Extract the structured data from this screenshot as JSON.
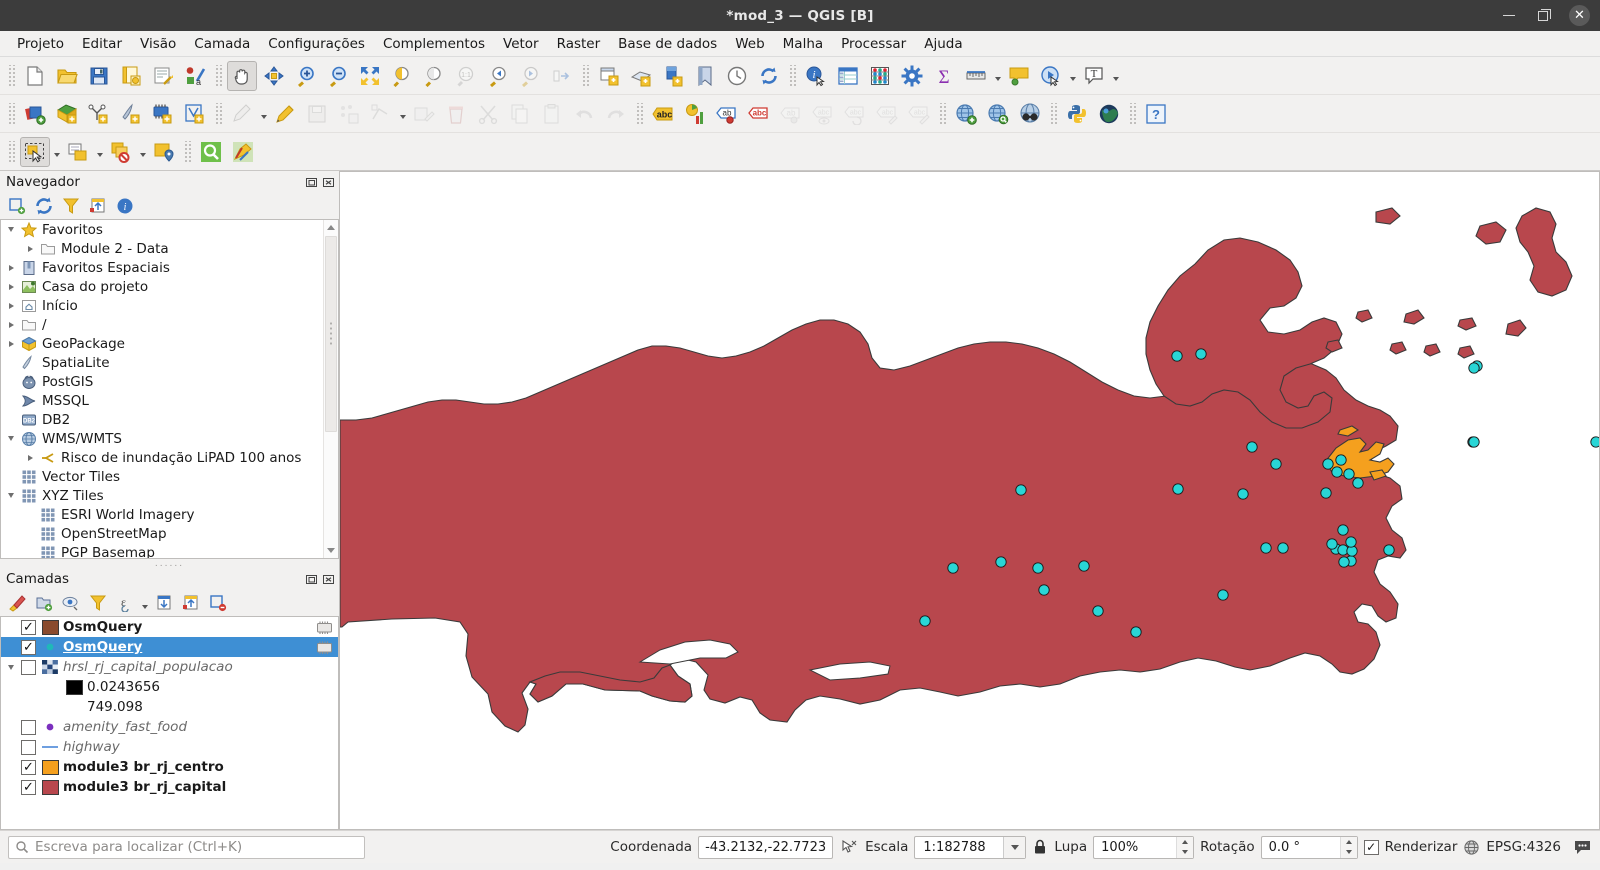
{
  "window": {
    "title": "*mod_3 — QGIS [B]",
    "minimize": "minimize",
    "maximize": "maximize",
    "close": "close"
  },
  "menubar": {
    "items": [
      {
        "label": "Projeto",
        "mnemonic": "P"
      },
      {
        "label": "Editar",
        "mnemonic": "E"
      },
      {
        "label": "Visão",
        "mnemonic": "V"
      },
      {
        "label": "Camada",
        "mnemonic": "C"
      },
      {
        "label": "Configurações",
        "mnemonic": "C"
      },
      {
        "label": "Complementos",
        "mnemonic": "C"
      },
      {
        "label": "Vetor",
        "mnemonic": "o"
      },
      {
        "label": "Raster",
        "mnemonic": "R"
      },
      {
        "label": "Base de dados",
        "mnemonic": "B"
      },
      {
        "label": "Web",
        "mnemonic": "W"
      },
      {
        "label": "Malha",
        "mnemonic": "M"
      },
      {
        "label": "Processar",
        "mnemonic": "c"
      },
      {
        "label": "Ajuda",
        "mnemonic": "A"
      }
    ]
  },
  "toolbar_row1": [
    {
      "name": "new-project-button",
      "icon": "new-document-icon"
    },
    {
      "name": "open-project-button",
      "icon": "open-folder-icon"
    },
    {
      "name": "save-project-button",
      "icon": "save-disk-icon"
    },
    {
      "name": "save-project-as-button",
      "icon": "save-as-icon"
    },
    {
      "name": "new-print-layout-button",
      "icon": "layout-designer-icon"
    },
    {
      "name": "style-manager-button",
      "icon": "style-manager-icon"
    },
    {
      "name": "pan-map-button",
      "icon": "pan-hand-icon",
      "pressed": true
    },
    {
      "name": "pan-to-selection-button",
      "icon": "pan-selection-icon"
    },
    {
      "name": "zoom-in-button",
      "icon": "zoom-in-icon"
    },
    {
      "name": "zoom-out-button",
      "icon": "zoom-out-icon"
    },
    {
      "name": "zoom-full-button",
      "icon": "zoom-full-icon"
    },
    {
      "name": "zoom-to-selection-button",
      "icon": "zoom-selection-icon"
    },
    {
      "name": "zoom-to-layer-button",
      "icon": "zoom-layer-icon"
    },
    {
      "name": "zoom-native-button",
      "icon": "zoom-native-1-1-icon",
      "dim": true
    },
    {
      "name": "zoom-last-button",
      "icon": "zoom-last-icon"
    },
    {
      "name": "zoom-next-button",
      "icon": "zoom-next-icon",
      "dim": true
    },
    {
      "name": "refresh-extent-button",
      "icon": "zoom-next-2-icon",
      "dim": true
    },
    {
      "name": "new-map-view-button",
      "icon": "new-map-view-icon"
    },
    {
      "name": "new-3d-map-view-button",
      "icon": "new-3d-map-view-icon"
    },
    {
      "name": "new-print-layout-2-button",
      "icon": "new-print-layout-icon"
    },
    {
      "name": "show-bookmarks-button",
      "icon": "bookmarks-icon"
    },
    {
      "name": "temporal-controller-button",
      "icon": "clock-icon"
    },
    {
      "name": "refresh-button",
      "icon": "refresh-icon"
    },
    {
      "name": "identify-features-button",
      "icon": "identify-info-icon"
    },
    {
      "name": "open-attribute-table-button",
      "icon": "attribute-table-icon"
    },
    {
      "name": "statistical-summary-button",
      "icon": "abacus-statistics-icon"
    },
    {
      "name": "processing-toolbox-button",
      "icon": "gear-processing-icon"
    },
    {
      "name": "field-calculator-button",
      "icon": "sigma-icon"
    },
    {
      "name": "measure-line-button",
      "icon": "ruler-measure-icon",
      "dropdown": true
    },
    {
      "name": "map-tips-button",
      "icon": "map-tips-icon"
    },
    {
      "name": "show-actions-button",
      "icon": "run-action-icon",
      "dropdown": true
    },
    {
      "name": "new-text-annotation-button",
      "icon": "text-annotation-icon",
      "dropdown": true
    }
  ],
  "toolbar_row2": [
    {
      "name": "open-data-source-manager-button",
      "icon": "data-source-manager-icon"
    },
    {
      "name": "add-vector-layer-button",
      "icon": "add-vector-layer-icon"
    },
    {
      "name": "add-delimited-text-layer-button",
      "icon": "add-delimited-text-icon"
    },
    {
      "name": "add-spatialite-layer-button",
      "icon": "add-spatialite-icon"
    },
    {
      "name": "add-mesh-layer-button",
      "icon": "add-mesh-layer-icon"
    },
    {
      "name": "add-virtual-layer-button",
      "icon": "add-virtual-layer-icon"
    },
    {
      "name": "current-edits-button",
      "icon": "current-edits-icon",
      "dim": true,
      "dropdown": true
    },
    {
      "name": "toggle-editing-button",
      "icon": "pencil-edit-icon"
    },
    {
      "name": "save-layer-edits-button",
      "icon": "save-edits-icon",
      "dim": true
    },
    {
      "name": "add-feature-button",
      "icon": "add-point-feature-icon",
      "dim": true
    },
    {
      "name": "vertex-tool-button",
      "icon": "vertex-tool-icon",
      "dim": true,
      "dropdown": true
    },
    {
      "name": "modify-attributes-button",
      "icon": "modify-attributes-icon",
      "dim": true
    },
    {
      "name": "delete-selected-button",
      "icon": "trash-delete-icon",
      "dim": true
    },
    {
      "name": "cut-features-button",
      "icon": "scissors-cut-icon",
      "dim": true
    },
    {
      "name": "copy-features-button",
      "icon": "copy-features-icon",
      "dim": true
    },
    {
      "name": "paste-features-button",
      "icon": "paste-features-icon",
      "dim": true
    },
    {
      "name": "undo-button",
      "icon": "undo-arrow-icon",
      "dim": true
    },
    {
      "name": "redo-button",
      "icon": "redo-arrow-icon",
      "dim": true
    },
    {
      "name": "layer-labeling-button",
      "icon": "label-abc-icon"
    },
    {
      "name": "layer-diagrams-button",
      "icon": "diagram-chart-icon"
    },
    {
      "name": "pin-labels-button",
      "icon": "pin-label-icon"
    },
    {
      "name": "highlight-labels-button",
      "icon": "highlight-label-icon"
    },
    {
      "name": "move-label-button",
      "icon": "move-label-icon",
      "dim": true
    },
    {
      "name": "show-hide-labels-button",
      "icon": "show-hide-label-icon",
      "dim": true
    },
    {
      "name": "rotate-label-button",
      "icon": "rotate-label-icon",
      "dim": true
    },
    {
      "name": "change-label-button",
      "icon": "change-label-icon",
      "dim": true
    },
    {
      "name": "label-properties-button",
      "icon": "label-properties-icon",
      "dim": true
    },
    {
      "name": "add-wms-layer-button",
      "icon": "globe-add-icon"
    },
    {
      "name": "metasearch-button",
      "icon": "globe-search-icon"
    },
    {
      "name": "inspect-globe-button",
      "icon": "globe-binoculars-icon"
    },
    {
      "name": "python-console-button",
      "icon": "python-console-icon"
    },
    {
      "name": "plugin-manager-button",
      "icon": "plugin-globe-icon"
    },
    {
      "name": "help-button",
      "icon": "help-question-icon"
    }
  ],
  "toolbar_row3": [
    {
      "name": "select-features-button",
      "icon": "select-features-icon",
      "pressed": true,
      "dropdown": true
    },
    {
      "name": "select-by-expression-button",
      "icon": "select-by-form-icon",
      "dropdown": true
    },
    {
      "name": "deselect-features-button",
      "icon": "deselect-all-icon",
      "dropdown": true
    },
    {
      "name": "select-value-button",
      "icon": "select-location-icon"
    },
    {
      "name": "osm-query-search-button",
      "icon": "magnifier-green-icon"
    },
    {
      "name": "qgis-plugin-button",
      "icon": "paint-plugin-icon"
    }
  ],
  "navigator": {
    "title": "Navegador",
    "panel_buttons": [
      {
        "name": "add-layer-button",
        "icon": "add-layer-icon"
      },
      {
        "name": "refresh-button",
        "icon": "refresh-icon"
      },
      {
        "name": "filter-browser-button",
        "icon": "filter-funnel-icon"
      },
      {
        "name": "collapse-all-button",
        "icon": "collapse-all-icon"
      },
      {
        "name": "show-properties-button",
        "icon": "info-icon"
      }
    ],
    "items": [
      {
        "label": "Favoritos",
        "icon": "star-icon",
        "indent": 0,
        "twisty": "down"
      },
      {
        "label": "Module 2 - Data",
        "icon": "folder-icon",
        "indent": 1,
        "twisty": "right"
      },
      {
        "label": "Favoritos Espaciais",
        "icon": "spatial-bookmark-icon",
        "indent": 0,
        "twisty": "right"
      },
      {
        "label": "Casa do projeto",
        "icon": "project-home-icon",
        "indent": 0,
        "twisty": "right"
      },
      {
        "label": "Início",
        "icon": "home-icon",
        "indent": 0,
        "twisty": "right"
      },
      {
        "label": "/",
        "icon": "folder-root-icon",
        "indent": 0,
        "twisty": "right"
      },
      {
        "label": "GeoPackage",
        "icon": "geopackage-icon",
        "indent": 0,
        "twisty": "right"
      },
      {
        "label": "SpatiaLite",
        "icon": "spatialite-icon",
        "indent": 0,
        "twisty": "none"
      },
      {
        "label": "PostGIS",
        "icon": "postgis-elephant-icon",
        "indent": 0,
        "twisty": "none"
      },
      {
        "label": "MSSQL",
        "icon": "mssql-icon",
        "indent": 0,
        "twisty": "none"
      },
      {
        "label": "DB2",
        "icon": "db2-icon",
        "indent": 0,
        "twisty": "none"
      },
      {
        "label": "WMS/WMTS",
        "icon": "wms-globe-icon",
        "indent": 0,
        "twisty": "down"
      },
      {
        "label": "Risco de inundação LiPAD 100 anos",
        "icon": "wms-connection-icon",
        "indent": 1,
        "twisty": "right"
      },
      {
        "label": "Vector Tiles",
        "icon": "vector-tiles-icon",
        "indent": 0,
        "twisty": "none"
      },
      {
        "label": "XYZ Tiles",
        "icon": "xyz-tiles-icon",
        "indent": 0,
        "twisty": "down"
      },
      {
        "label": "ESRI World Imagery",
        "icon": "xyz-tile-icon",
        "indent": 1,
        "twisty": "none"
      },
      {
        "label": "OpenStreetMap",
        "icon": "xyz-tile-icon",
        "indent": 1,
        "twisty": "none"
      },
      {
        "label": "PGP Basemap",
        "icon": "xyz-tile-icon",
        "indent": 1,
        "twisty": "none"
      }
    ]
  },
  "layers": {
    "title": "Camadas",
    "panel_buttons": [
      {
        "name": "open-layer-styling-button",
        "icon": "style-brush-icon"
      },
      {
        "name": "add-group-button",
        "icon": "add-group-icon"
      },
      {
        "name": "manage-visibility-button",
        "icon": "eye-visibility-icon"
      },
      {
        "name": "filter-legend-button",
        "icon": "filter-funnel-icon"
      },
      {
        "name": "filter-legend-expression-button",
        "icon": "epsilon-filter-icon",
        "dropdown": true
      },
      {
        "name": "expand-all-button",
        "icon": "expand-all-icon"
      },
      {
        "name": "collapse-all-button",
        "icon": "collapse-all-icon"
      },
      {
        "name": "remove-layer-button",
        "icon": "remove-layer-icon"
      }
    ],
    "items": [
      {
        "label": "OsmQuery",
        "checked": true,
        "symbol": "swatch",
        "color": "#8a4b2e",
        "style": "bold",
        "indent": 0,
        "selected": false,
        "badge": "editable-icon"
      },
      {
        "label": "OsmQuery",
        "checked": true,
        "symbol": "dot",
        "color": "#1fb8b8",
        "style": "bold",
        "indent": 0,
        "selected": true,
        "badge": "editable-icon"
      },
      {
        "label": "hrsl_rj_capital_populacao",
        "checked": false,
        "symbol": "raster",
        "color": "#2b4a8c",
        "style": "italic",
        "indent": 0,
        "selected": false,
        "twisty": "down"
      },
      {
        "label": "0.0243656",
        "checked": null,
        "symbol": "swatch",
        "color": "#000000",
        "style": "plain",
        "indent": 1,
        "selected": false
      },
      {
        "label": "749.098",
        "checked": null,
        "symbol": "none",
        "color": "#ffffff",
        "style": "plain",
        "indent": 1,
        "selected": false
      },
      {
        "label": "amenity_fast_food",
        "checked": false,
        "symbol": "dot",
        "color": "#7b2fbe",
        "style": "italic",
        "indent": 0,
        "selected": false
      },
      {
        "label": "highway",
        "checked": false,
        "symbol": "line",
        "color": "#6e9fe0",
        "style": "italic",
        "indent": 0,
        "selected": false
      },
      {
        "label": "module3 br_rj_centro",
        "checked": true,
        "symbol": "swatch",
        "color": "#f5a01e",
        "style": "bold",
        "indent": 0,
        "selected": false
      },
      {
        "label": "module3 br_rj_capital",
        "checked": true,
        "symbol": "swatch",
        "color": "#b8474d",
        "style": "bold",
        "indent": 0,
        "selected": false
      }
    ]
  },
  "map": {
    "capital_fill": "#b8474d",
    "centro_fill": "#f5a01e",
    "point_fill": "#29d6d6",
    "background": "#ffffff",
    "outline": "#3a3a3a"
  },
  "statusbar": {
    "locator_placeholder": "Escreva para localizar (Ctrl+K)",
    "coordinate_label": "Coordenada",
    "coordinate_value": "-43.2132,-22.7723",
    "scale_label": "Escala",
    "scale_value": "1:182788",
    "magnifier_label": "Lupa",
    "magnifier_value": "100%",
    "rotation_label": "Rotação",
    "rotation_value": "0.0 °",
    "render_label": "Renderizar",
    "render_checked": true,
    "crs_label": "EPSG:4326",
    "lock_icon": "lock-icon",
    "messages_icon": "messages-bubble-icon"
  }
}
